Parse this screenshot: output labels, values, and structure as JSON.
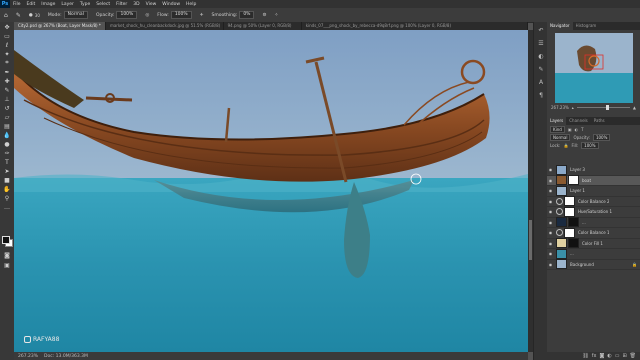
{
  "menubar": {
    "logo": "Ps",
    "items": [
      "File",
      "Edit",
      "Image",
      "Layer",
      "Type",
      "Select",
      "Filter",
      "3D",
      "View",
      "Window",
      "Help"
    ]
  },
  "options": {
    "mode_label": "Mode:",
    "mode_value": "Normal",
    "opacity_label": "Opacity:",
    "opacity_value": "100%",
    "flow_label": "Flow:",
    "flow_value": "100%",
    "smoothing_label": "Smoothing:",
    "smoothing_value": "0%"
  },
  "tabs": [
    {
      "label": "City2.psd @ 267% (Boat, Layer Mask/8) *",
      "active": true
    },
    {
      "label": "market_shock_hu_cleanbackdock.jpg @ 51.5% (RGB/8)",
      "active": false
    },
    {
      "label": "94.png @ 50% (Layer 0, RGB/8)",
      "active": false
    },
    {
      "label": "kinds_07___png_shock_by_rebecca-d9q8rf.png @ 100% (Layer 0, RGB/8)",
      "active": false
    }
  ],
  "status": {
    "zoom": "267.23%",
    "doc": "Doc: 13.0M/363.3M"
  },
  "watermark": "RAFYA88",
  "navigator": {
    "tabs": [
      "Navigator",
      "Histogram"
    ],
    "zoom": "267.23%"
  },
  "layers_panel": {
    "tabs": [
      "Layers",
      "Channels",
      "Paths"
    ],
    "kind": "Kind",
    "blend_mode": "Normal",
    "opacity_label": "Opacity:",
    "opacity_value": "100%",
    "lock_label": "Lock:",
    "fill_label": "Fill:",
    "fill_value": "100%",
    "layers": [
      {
        "name": "Layer 3",
        "selected": false,
        "mask": false,
        "adjust": false,
        "thumb": "#8ba9c9"
      },
      {
        "name": "boat",
        "selected": true,
        "mask": true,
        "adjust": false,
        "thumb": "#8a5a30"
      },
      {
        "name": "Layer 1",
        "selected": false,
        "mask": false,
        "adjust": false,
        "thumb": "#9bb4cc"
      },
      {
        "name": "Color Balance 2",
        "selected": false,
        "mask": true,
        "adjust": true,
        "thumb": "#666666"
      },
      {
        "name": "Hue/Saturation 1",
        "selected": false,
        "mask": true,
        "adjust": true,
        "thumb": "#666666"
      },
      {
        "name": "...",
        "selected": false,
        "mask": true,
        "adjust": false,
        "thumb": "#1a2a40"
      },
      {
        "name": "Color Balance 1",
        "selected": false,
        "mask": true,
        "adjust": true,
        "thumb": "#666666"
      },
      {
        "name": "Color Fill 1",
        "selected": false,
        "mask": true,
        "adjust": true,
        "thumb": "#e0d0a0"
      },
      {
        "name": "...",
        "selected": false,
        "mask": false,
        "adjust": false,
        "thumb": "#3a90a8"
      },
      {
        "name": "Background",
        "selected": false,
        "mask": false,
        "adjust": false,
        "thumb": "#9bb4cc"
      }
    ]
  },
  "tools": [
    "move-icon",
    "marquee-icon",
    "lasso-icon",
    "quick-select-icon",
    "crop-icon",
    "eyedropper-icon",
    "healing-icon",
    "brush-icon",
    "clone-stamp-icon",
    "history-brush-icon",
    "eraser-icon",
    "gradient-icon",
    "blur-icon",
    "dodge-icon",
    "pen-icon",
    "type-icon",
    "path-select-icon",
    "shape-icon",
    "hand-icon",
    "zoom-icon",
    "more-icon"
  ],
  "colors": {
    "accent": "#31a8ff",
    "water": "#2f9bb5",
    "sky": "#8ba9c9",
    "wood": "#8a4a22"
  }
}
